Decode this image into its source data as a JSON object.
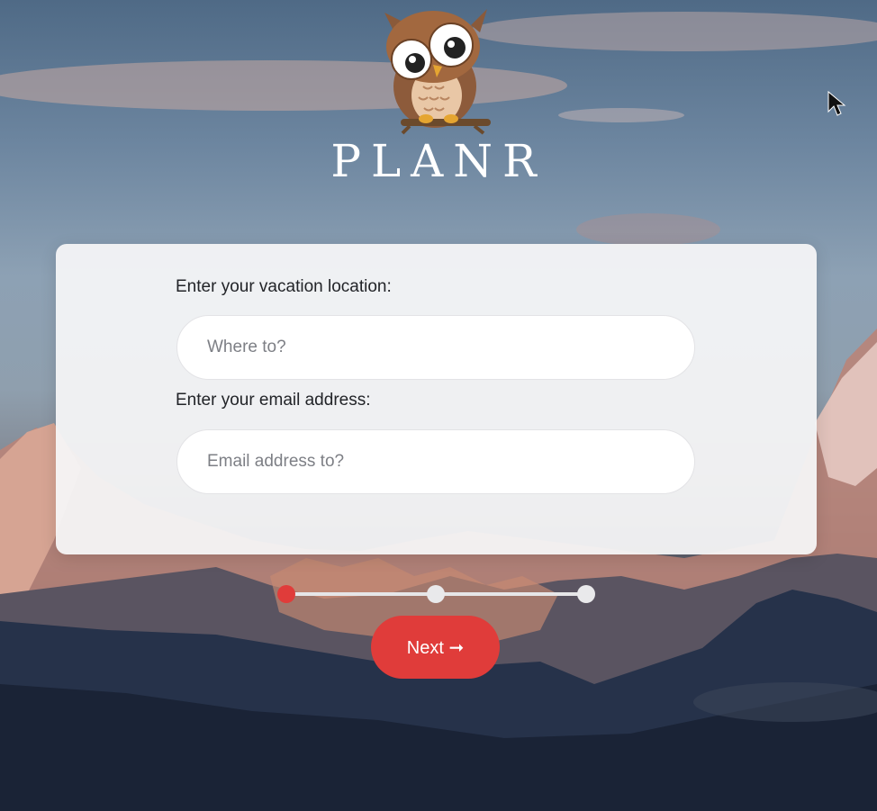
{
  "brand": {
    "name": "PLANR",
    "logo_icon": "owl-icon"
  },
  "form": {
    "location_label": "Enter your vacation location:",
    "location_placeholder": "Where to?",
    "location_value": "",
    "email_label": "Enter your email address:",
    "email_placeholder": "Email address to?",
    "email_value": ""
  },
  "stepper": {
    "current_step": 1,
    "total_steps": 3
  },
  "actions": {
    "next_label": "Next ➞"
  },
  "colors": {
    "accent": "#e03c3a",
    "card": "#f5f5f6",
    "text": "#222428"
  }
}
